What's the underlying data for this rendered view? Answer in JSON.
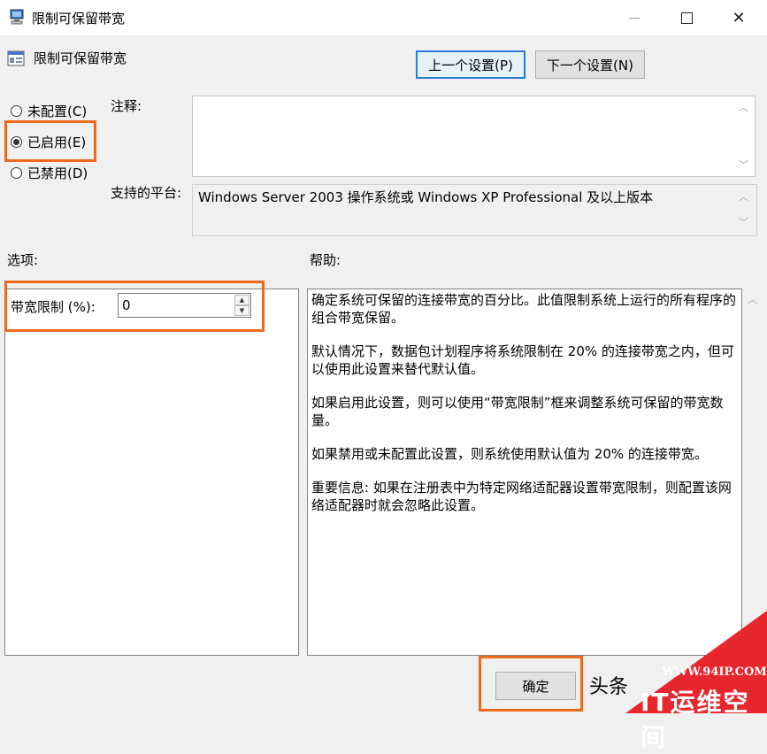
{
  "window": {
    "title": "限制可保留带宽",
    "minimize_icon": "minimize-icon",
    "maximize_icon": "maximize-icon",
    "close_icon": "close-icon",
    "close_glyph": "✕"
  },
  "header": {
    "policy_title": "限制可保留带宽",
    "prev_button": "上一个设置(P)",
    "next_button": "下一个设置(N)"
  },
  "state": {
    "options": [
      {
        "label": "未配置(C)",
        "checked": false
      },
      {
        "label": "已启用(E)",
        "checked": true
      },
      {
        "label": "已禁用(D)",
        "checked": false
      }
    ]
  },
  "comment": {
    "label": "注释:",
    "value": ""
  },
  "platform": {
    "label": "支持的平台:",
    "value": "Windows Server 2003 操作系统或 Windows XP Professional 及以上版本"
  },
  "options_section": {
    "label": "选项:",
    "bandwidth_label": "带宽限制 (%):",
    "bandwidth_value": "0",
    "spin_up": "▲",
    "spin_down": "▼"
  },
  "help_section": {
    "label": "帮助:",
    "paragraphs": [
      "确定系统可保留的连接带宽的百分比。此值限制系统上运行的所有程序的组合带宽保留。",
      "默认情况下，数据包计划程序将系统限制在 20% 的连接带宽之内，但可以使用此设置来替代默认值。",
      "如果启用此设置，则可以使用“带宽限制”框来调整系统可保留的带宽数量。",
      "如果禁用或未配置此设置，则系统使用默认值为 20% 的连接带宽。",
      "重要信息: 如果在注册表中为特定网络适配器设置带宽限制，则配置该网络适配器时就会忽略此设置。"
    ]
  },
  "footer": {
    "ok_button": "确定",
    "partial_text": "头条"
  },
  "watermark": {
    "url": "WWW.94IP.COM",
    "name": "IT运维空间"
  },
  "colors": {
    "highlight": "#ec6a1e",
    "focus_border": "#2a7ad5",
    "watermark": "#e8262d"
  },
  "scroll": {
    "up": "︿",
    "down": "﹀"
  }
}
